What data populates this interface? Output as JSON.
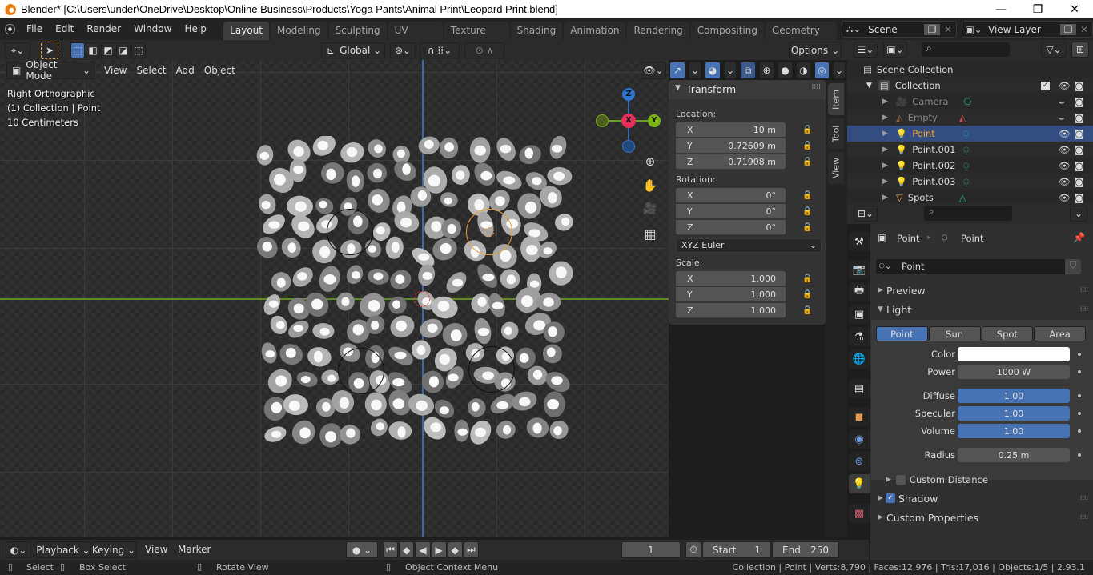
{
  "window": {
    "title": "Blender* [C:\\Users\\under\\OneDrive\\Desktop\\Online Business\\Products\\Yoga Pants\\Animal Print\\Leopard Print.blend]",
    "minimize": "—",
    "maximize": "❐",
    "close": "✕"
  },
  "menubar": {
    "items": [
      "File",
      "Edit",
      "Render",
      "Window",
      "Help"
    ]
  },
  "workspaces": {
    "tabs": [
      "Layout",
      "Modeling",
      "Sculpting",
      "UV Editing",
      "Texture Paint",
      "Shading",
      "Animation",
      "Rendering",
      "Compositing",
      "Geometry Nod"
    ],
    "active": "Layout"
  },
  "scene": {
    "name": "Scene",
    "view_layer": "View Layer"
  },
  "viewport_header": {
    "mode": "Object Mode",
    "menus": [
      "View",
      "Select",
      "Add",
      "Object"
    ],
    "orientation": "Global",
    "options_label": "Options"
  },
  "viewport_overlay": {
    "view_name": "Right Orthographic",
    "collection_info": "(1) Collection | Point",
    "scale": "10 Centimeters"
  },
  "gizmo": {
    "z": "Z",
    "x": "X",
    "y": "Y"
  },
  "npanel": {
    "section": "Transform",
    "location_label": "Location:",
    "location": [
      {
        "axis": "X",
        "value": "10 m"
      },
      {
        "axis": "Y",
        "value": "0.72609 m"
      },
      {
        "axis": "Z",
        "value": "0.71908 m"
      }
    ],
    "rotation_label": "Rotation:",
    "rotation": [
      {
        "axis": "X",
        "value": "0°"
      },
      {
        "axis": "Y",
        "value": "0°"
      },
      {
        "axis": "Z",
        "value": "0°"
      }
    ],
    "rotation_mode": "XYZ Euler",
    "scale_label": "Scale:",
    "scale": [
      {
        "axis": "X",
        "value": "1.000"
      },
      {
        "axis": "Y",
        "value": "1.000"
      },
      {
        "axis": "Z",
        "value": "1.000"
      }
    ],
    "tabs": [
      "Item",
      "Tool",
      "View"
    ]
  },
  "outliner": {
    "root": "Scene Collection",
    "collection": "Collection",
    "items": [
      {
        "name": "Camera",
        "type": "camera",
        "visible": false,
        "selected": false
      },
      {
        "name": "Empty",
        "type": "empty",
        "visible": false,
        "selected": false
      },
      {
        "name": "Point",
        "type": "light",
        "visible": true,
        "selected": true
      },
      {
        "name": "Point.001",
        "type": "light",
        "visible": true,
        "selected": false
      },
      {
        "name": "Point.002",
        "type": "light",
        "visible": true,
        "selected": false
      },
      {
        "name": "Point.003",
        "type": "light",
        "visible": true,
        "selected": false
      },
      {
        "name": "Spots",
        "type": "mesh",
        "visible": true,
        "selected": false
      }
    ]
  },
  "properties": {
    "breadcrumb_object": "Point",
    "breadcrumb_data": "Point",
    "datablock_name": "Point",
    "preview_label": "Preview",
    "light_label": "Light",
    "light_types": [
      "Point",
      "Sun",
      "Spot",
      "Area"
    ],
    "active_light_type": "Point",
    "color_label": "Color",
    "color_value": "#ffffff",
    "power_label": "Power",
    "power": "1000 W",
    "diffuse_label": "Diffuse",
    "diffuse": "1.00",
    "specular_label": "Specular",
    "specular": "1.00",
    "volume_label": "Volume",
    "volume": "1.00",
    "radius_label": "Radius",
    "radius": "0.25 m",
    "custom_distance_label": "Custom Distance",
    "custom_distance_checked": false,
    "shadow_label": "Shadow",
    "shadow_checked": true,
    "custom_properties_label": "Custom Properties"
  },
  "timeline": {
    "menus": [
      "Playback",
      "Keying",
      "View",
      "Marker"
    ],
    "current_frame": "1",
    "start_label": "Start",
    "start": "1",
    "end_label": "End",
    "end": "250"
  },
  "statusbar": {
    "select": "Select",
    "box_select": "Box Select",
    "rotate_view": "Rotate View",
    "context_menu": "Object Context Menu",
    "stats": "Collection | Point | Verts:8,790 | Faces:12,976 | Tris:17,016 | Objects:1/5 | 2.93.1"
  },
  "colors": {
    "accent_blue": "#4772b3",
    "selection_orange": "#f0a030",
    "axis_x": "#ff3352",
    "axis_y": "#8bdc00",
    "axis_z": "#2890ff",
    "light_green": "#1fbf8f"
  }
}
